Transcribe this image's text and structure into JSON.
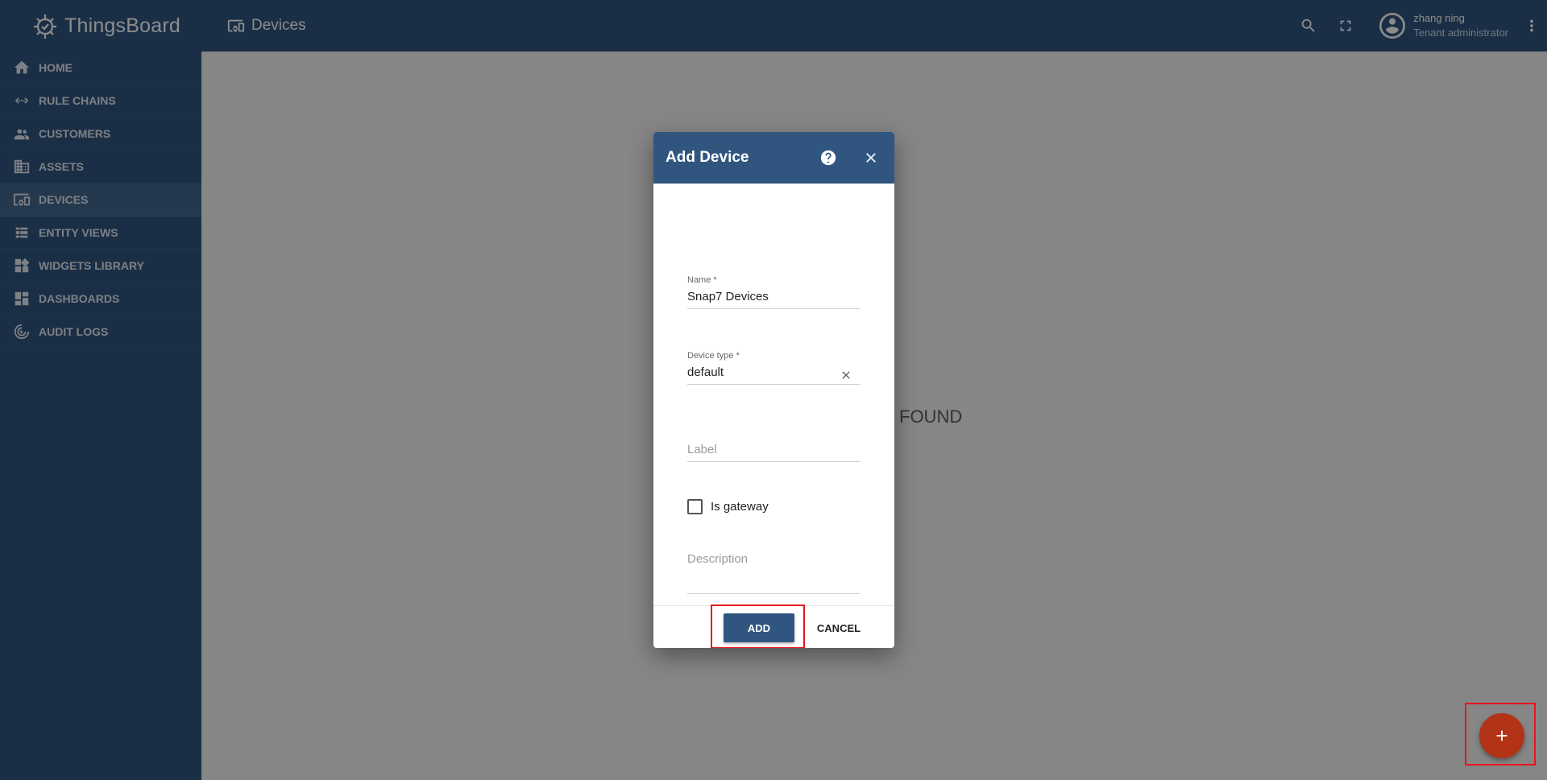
{
  "app": {
    "name": "ThingsBoard"
  },
  "sidebar": {
    "items": [
      {
        "label": "HOME",
        "icon": "home-icon"
      },
      {
        "label": "RULE CHAINS",
        "icon": "rule-chains-icon"
      },
      {
        "label": "CUSTOMERS",
        "icon": "customers-icon"
      },
      {
        "label": "ASSETS",
        "icon": "assets-icon"
      },
      {
        "label": "DEVICES",
        "icon": "devices-icon",
        "active": true
      },
      {
        "label": "ENTITY VIEWS",
        "icon": "entity-views-icon"
      },
      {
        "label": "WIDGETS LIBRARY",
        "icon": "widgets-icon"
      },
      {
        "label": "DASHBOARDS",
        "icon": "dashboards-icon"
      },
      {
        "label": "AUDIT LOGS",
        "icon": "audit-logs-icon"
      }
    ]
  },
  "header": {
    "title": "Devices",
    "user": {
      "name": "zhang ning",
      "role": "Tenant administrator"
    }
  },
  "main": {
    "empty_text": "FOUND"
  },
  "dialog": {
    "title": "Add Device",
    "fields": {
      "name": {
        "label": "Name *",
        "value": "Snap7 Devices"
      },
      "device_type": {
        "label": "Device type *",
        "value": "default"
      },
      "label": {
        "placeholder": "Label"
      },
      "is_gateway": {
        "label": "Is gateway",
        "checked": false
      },
      "description": {
        "placeholder": "Description"
      }
    },
    "buttons": {
      "add": "ADD",
      "cancel": "CANCEL"
    }
  },
  "colors": {
    "primary": "#305680",
    "fab": "#b33316",
    "highlight": "#e8141c"
  }
}
